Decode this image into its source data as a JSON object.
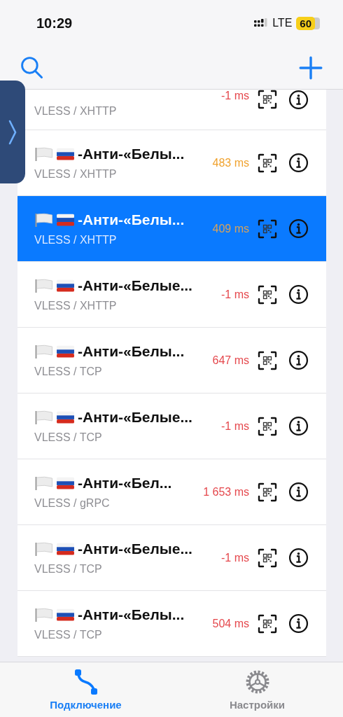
{
  "status_bar": {
    "time": "10:29",
    "network": "LTE",
    "battery": "60"
  },
  "servers": [
    {
      "latency": "-1 ms",
      "color": "#e5484d",
      "protocol": "VLESS / XHTTP",
      "selected": false
    },
    {
      "title": "-Анти-«Белы...",
      "latency": "483 ms",
      "color": "#f0a22e",
      "protocol": "VLESS / XHTTP",
      "selected": false
    },
    {
      "title": "-Анти-«Белы...",
      "latency": "409 ms",
      "color": "#d9a25a",
      "protocol": "VLESS / XHTTP",
      "selected": true
    },
    {
      "title": "-Анти-«Белые...",
      "latency": "-1 ms",
      "color": "#e5484d",
      "protocol": "VLESS / XHTTP",
      "selected": false
    },
    {
      "title": "-Анти-«Белы...",
      "latency": "647 ms",
      "color": "#e5484d",
      "protocol": "VLESS / TCP",
      "selected": false
    },
    {
      "title": "-Анти-«Белые...",
      "latency": "-1 ms",
      "color": "#e5484d",
      "protocol": "VLESS / TCP",
      "selected": false
    },
    {
      "title": "-Анти-«Бел...",
      "latency": "1 653 ms",
      "color": "#e5484d",
      "protocol": "VLESS / gRPC",
      "selected": false
    },
    {
      "title": "-Анти-«Белые...",
      "latency": "-1 ms",
      "color": "#e5484d",
      "protocol": "VLESS / TCP",
      "selected": false
    },
    {
      "title": "-Анти-«Белы...",
      "latency": "504 ms",
      "color": "#e5484d",
      "protocol": "VLESS / TCP",
      "selected": false
    }
  ],
  "tabs": [
    {
      "label": "Подключение",
      "kind": "connection",
      "selected": true
    },
    {
      "label": "Настройки",
      "kind": "settings",
      "selected": false
    }
  ]
}
